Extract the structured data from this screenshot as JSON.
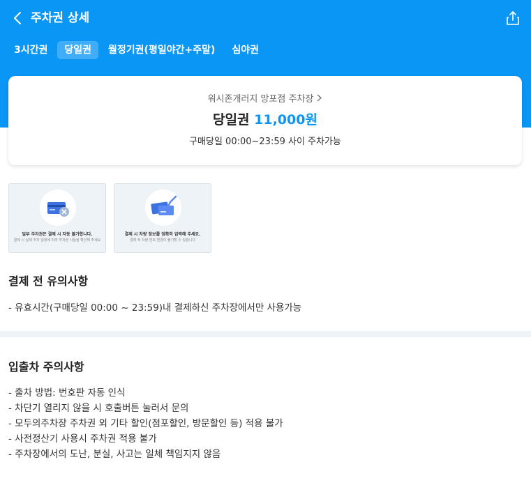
{
  "header": {
    "title": "주차권 상세",
    "back_icon": "chevron-left-icon",
    "share_icon": "share-icon"
  },
  "tabs": [
    {
      "label": "3시간권",
      "active": false
    },
    {
      "label": "당일권",
      "active": true
    },
    {
      "label": "월정기권(평일야간+주말)",
      "active": false
    },
    {
      "label": "심야권",
      "active": false
    }
  ],
  "ticket": {
    "lot_name": "워시존개러지 망포점 주차장",
    "name": "당일권",
    "price": "11,000원",
    "description": "구매당일 00:00~23:59 사이 주차가능"
  },
  "guide_images": [
    {
      "caption": "일부 주차권은 결제 시 자동 불가합니다.",
      "sub": "결제 시 실제 주차 일정에 따라 주차권 사용을 확인해 주세요",
      "icon": "card-cancel-icon"
    },
    {
      "caption": "결제 시 차량 정보를 정확히 입력해 주세요.",
      "sub": "결제 후 차량 번호 변경이 불가할 수 있습니다",
      "icon": "card-check-icon"
    }
  ],
  "payment_notice": {
    "title": "결제 전 유의사항",
    "lines": [
      "- 유효시간(구매당일 00:00 ~ 23:59)내 결제하신 주차장에서만 사용가능"
    ]
  },
  "entry_notice": {
    "title": "입출차 주의사항",
    "lines": [
      "- 출차 방법: 번호판 자동 인식",
      "- 차단기 열리지 않을 시 호출버튼 눌러서 문의",
      "- 모두의주차장 주차권 외 기타 할인(점포할인, 방문할인 등) 적용 불가",
      "- 사전정산기 사용시 주차권 적용 불가",
      "- 주차장에서의 도난, 분실, 사고는 일체 책임지지 않음"
    ]
  },
  "colors": {
    "brand_blue": "#0a96f5",
    "divider": "#eef3f7"
  }
}
